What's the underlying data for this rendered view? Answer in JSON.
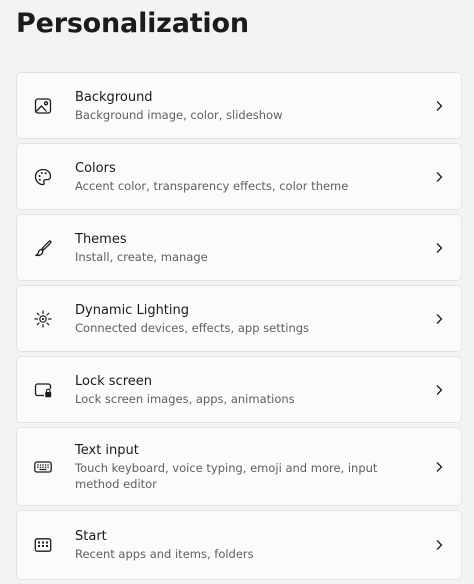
{
  "page": {
    "title": "Personalization"
  },
  "settings": [
    {
      "title": "Background",
      "description": "Background image, color, slideshow",
      "icon": "image-icon"
    },
    {
      "title": "Colors",
      "description": "Accent color, transparency effects, color theme",
      "icon": "palette-icon"
    },
    {
      "title": "Themes",
      "description": "Install, create, manage",
      "icon": "brush-icon"
    },
    {
      "title": "Dynamic Lighting",
      "description": "Connected devices, effects, app settings",
      "icon": "lighting-icon"
    },
    {
      "title": "Lock screen",
      "description": "Lock screen images, apps, animations",
      "icon": "lock-screen-icon"
    },
    {
      "title": "Text input",
      "description": "Touch keyboard, voice typing, emoji and more, input method editor",
      "icon": "keyboard-icon"
    },
    {
      "title": "Start",
      "description": "Recent apps and items, folders",
      "icon": "start-icon"
    }
  ],
  "colors": {
    "background": "#f3f3f3",
    "card": "#fbfbfb",
    "border": "#e3e3e3",
    "text_primary": "#1b1b1b",
    "text_secondary": "#5f5f5f"
  }
}
